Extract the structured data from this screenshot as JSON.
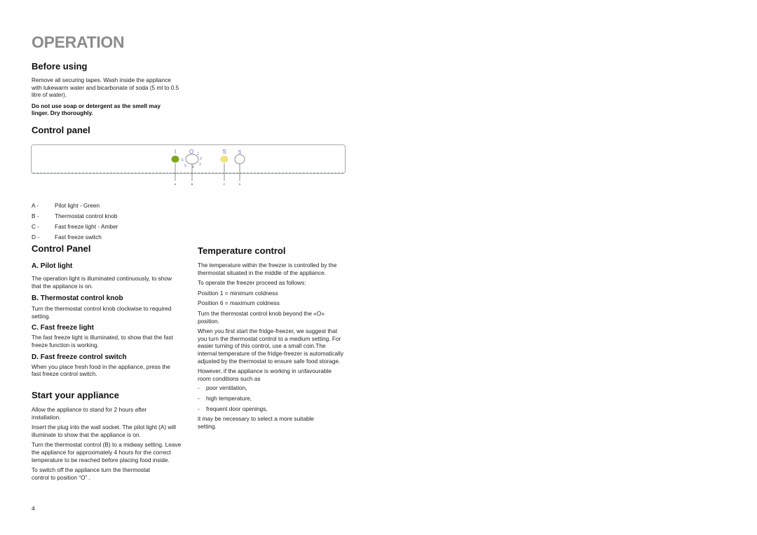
{
  "page": {
    "title": "OPERATION",
    "page_number": "4"
  },
  "before_using": {
    "heading": "Before using",
    "para1": "Remove all securing tapes. Wash inside the appliance with lukewarm water and bicarbonate of soda (5 ml to 0.5 litre of water).",
    "para2": "Do not use soap or detergent as the smell may linger. Dry thoroughly."
  },
  "control_panel_diagram": {
    "heading": "Control panel",
    "symbols": {
      "pilot": "I",
      "knob_zero": "O",
      "fast_freeze_light": "S",
      "fast_freeze_switch": "S"
    },
    "knob_positions": [
      "1",
      "2",
      "3",
      "4",
      "5",
      "6"
    ],
    "callouts": [
      "A",
      "B",
      "C",
      "D"
    ],
    "colors": {
      "pilot_light": "#7aa51a",
      "fast_freeze_light": "#f3e27a",
      "symbol": "#6b6bc8"
    },
    "legend": [
      {
        "key": "A -",
        "label": "Pilot light - Green"
      },
      {
        "key": "B -",
        "label": "Thermostat control knob"
      },
      {
        "key": "C -",
        "label": "Fast freeze light - Amber"
      },
      {
        "key": "D -",
        "label": "Fast freeze switch"
      }
    ]
  },
  "control_panel_section": {
    "heading": "Control Panel",
    "items": [
      {
        "heading": "A. Pilot light",
        "text": "The operation light is illuminated continuously, to show that the appliance is on."
      },
      {
        "heading": "B. Thermostat control knob",
        "text": "Turn the thermostat control knob clockwise to required setting."
      },
      {
        "heading": "C. Fast freeze light",
        "text": "The fast freeze light is illuminated, to show that the fast freeze function is working."
      },
      {
        "heading": "D. Fast freeze control switch",
        "text": "When you place fresh food in the appliance, press the fast freeze control switch."
      }
    ]
  },
  "start_appliance": {
    "heading": "Start your appliance",
    "paras": [
      "Allow the appliance to stand for 2 hours after installation.",
      "Insert the plug into the wall socket. The pilot light (A) will illuminate to show that the appliance is on.",
      "Turn the thermostat control (B) to a midway setting. Leave the appliance for approximately 4 hours for the correct temperature to be reached before placing food inside.",
      "To switch off the appliance turn the thermostat control to position “O” ."
    ]
  },
  "temperature_control": {
    "heading": "Temperature control",
    "paras": [
      "The temperature within the freezer is controlled by the thermostat situated in the middle of the appliance.",
      "To operate the freezer proceed as follows:",
      "Position 1 = minimum coldness",
      "Position 6 = maximum coldness",
      "Turn the thermostat control knob beyond the «O» position.",
      "When you first start the fridge-freezer, we suggest that you turn the thermostat control to a medium setting. For easier turning of this control, use a small coin.The internal temperature of the fridge-freezer is automatically adjusted by the thermostat to ensure safe food storage.",
      "However, if the appliance is working in unfavourable room conditions such as"
    ],
    "bullets": [
      "poor ventilation,",
      "high temperature,",
      "frequent door openings,"
    ],
    "bullet_marker": "-",
    "closing": "it may be necessary to select a more suitable setting."
  }
}
